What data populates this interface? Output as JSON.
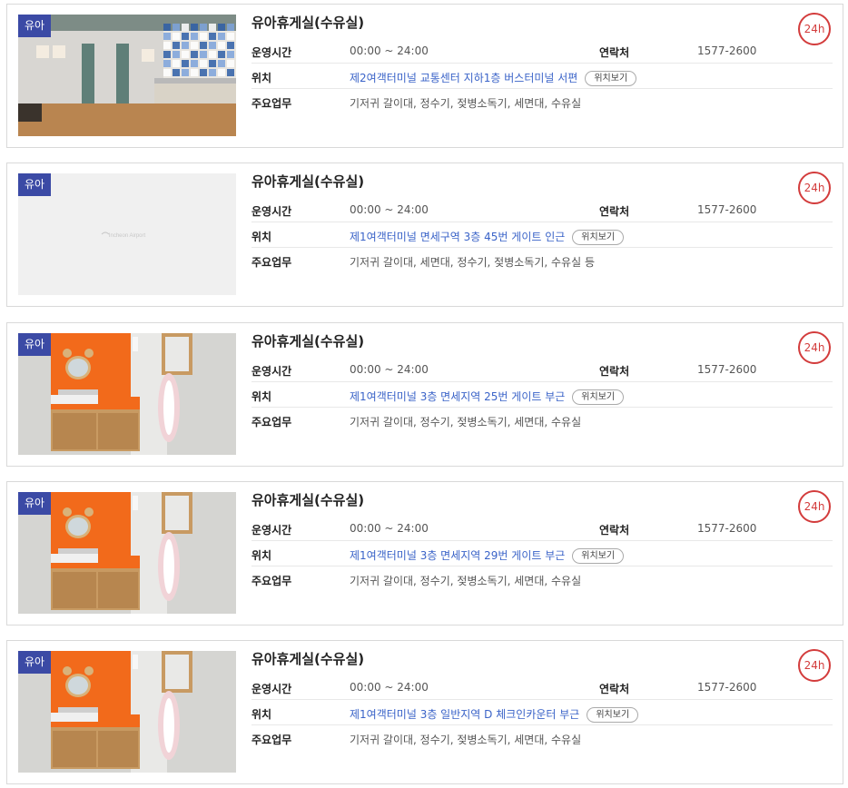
{
  "labels": {
    "category": "유아",
    "hours_label": "운영시간",
    "contact_label": "연락처",
    "location_label": "위치",
    "services_label": "주요업무",
    "location_button": "위치보기",
    "badge_24h": "24h"
  },
  "placeholder_logo": "Incheon Airport",
  "facilities": [
    {
      "title": "유아휴게실(수유실)",
      "hours": "00:00 ~ 24:00",
      "contact": "1577-2600",
      "location": "제2여객터미널 교통센터 지하1층 버스터미널 서편",
      "services": "기저귀 갈이대, 정수기, 젖병소독기, 세면대, 수유실"
    },
    {
      "title": "유아휴게실(수유실)",
      "hours": "00:00 ~ 24:00",
      "contact": "1577-2600",
      "location": "제1여객터미널 면세구역 3층 45번 게이트 인근",
      "services": "기저귀 갈이대, 세면대, 정수기, 젖병소독기, 수유실 등"
    },
    {
      "title": "유아휴게실(수유실)",
      "hours": "00:00 ~ 24:00",
      "contact": "1577-2600",
      "location": "제1여객터미널 3층 면세지역 25번 게이트 부근",
      "services": "기저귀 갈이대, 정수기, 젖병소독기, 세면대, 수유실"
    },
    {
      "title": "유아휴게실(수유실)",
      "hours": "00:00 ~ 24:00",
      "contact": "1577-2600",
      "location": "제1여객터미널 3층 면세지역 29번 게이트 부근",
      "services": "기저귀 갈이대, 정수기, 젖병소독기, 세면대, 수유실"
    },
    {
      "title": "유아휴게실(수유실)",
      "hours": "00:00 ~ 24:00",
      "contact": "1577-2600",
      "location": "제1여객터미널 3층 일반지역 D 체크인카운터 부근",
      "services": "기저귀 갈이대, 정수기, 젖병소독기, 세면대, 수유실"
    }
  ],
  "colors": {
    "badge_bg": "#3b4aa5",
    "accent_red": "#d33c3c",
    "link_blue": "#3a63c8",
    "orange_wall": "#f26a1b"
  }
}
